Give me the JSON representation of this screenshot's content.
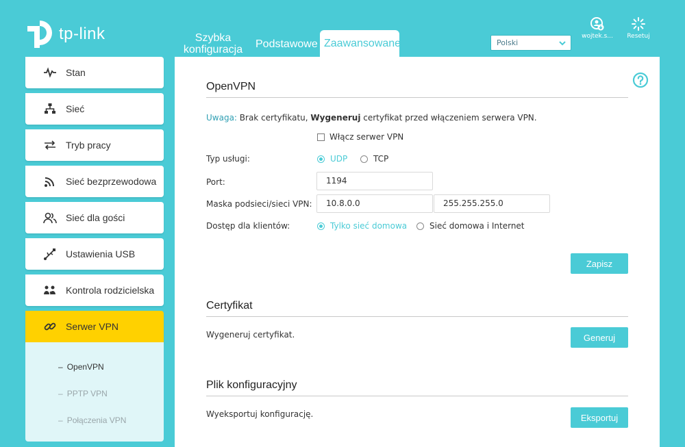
{
  "brand": {
    "logo_text": "tp-link"
  },
  "topnav": {
    "tabs": [
      {
        "label": "Szybka konfiguracja"
      },
      {
        "label": "Podstawowe"
      },
      {
        "label": "Zaawansowane"
      }
    ]
  },
  "language": {
    "selected": "Polski"
  },
  "header_actions": {
    "user_label": "wojtek.s...",
    "reset_label": "Resetuj"
  },
  "sidebar": {
    "items": [
      {
        "label": "Stan",
        "icon": "pulse-icon"
      },
      {
        "label": "Sieć",
        "icon": "network-icon"
      },
      {
        "label": "Tryb pracy",
        "icon": "swap-icon"
      },
      {
        "label": "Sieć bezprzewodowa",
        "icon": "wifi-icon"
      },
      {
        "label": "Sieć dla gości",
        "icon": "guests-icon"
      },
      {
        "label": "Ustawienia USB",
        "icon": "usb-icon"
      },
      {
        "label": "Kontrola rodzicielska",
        "icon": "family-icon"
      },
      {
        "label": "Serwer VPN",
        "icon": "link-icon"
      }
    ],
    "subitems": [
      {
        "label": "OpenVPN",
        "dash": "–"
      },
      {
        "label": "PPTP VPN",
        "dash": "–"
      },
      {
        "label": "Połączenia VPN",
        "dash": "–"
      }
    ]
  },
  "openvpn": {
    "title": "OpenVPN",
    "note_prefix": "Uwaga:",
    "note_text1": " Brak certyfikatu, ",
    "note_bold": "Wygeneruj",
    "note_text2": " certyfikat przed włączeniem serwera VPN.",
    "enable_label": "Włącz serwer VPN",
    "enable_checked": false,
    "service_type_label": "Typ usługi:",
    "service_options": [
      "UDP",
      "TCP"
    ],
    "service_selected": "UDP",
    "port_label": "Port:",
    "port_value": "1194",
    "mask_label": "Maska podsieci/sieci VPN:",
    "subnet_value": "10.8.0.0",
    "netmask_value": "255.255.255.0",
    "access_label": "Dostęp dla klientów:",
    "access_options": [
      "Tylko sieć domowa",
      "Sieć domowa i Internet"
    ],
    "access_selected": "Tylko sieć domowa",
    "save_label": "Zapisz"
  },
  "certificate": {
    "title": "Certyfikat",
    "text": "Wygeneruj certyfikat.",
    "button_label": "Generuj"
  },
  "config_file": {
    "title": "Plik konfiguracyjny",
    "text": "Wyeksportuj konfigurację.",
    "button_label": "Eksportuj"
  },
  "colors": {
    "accent": "#4acbd6",
    "active_menu": "#ffd100",
    "submenu_bg": "#e0f6f8"
  }
}
